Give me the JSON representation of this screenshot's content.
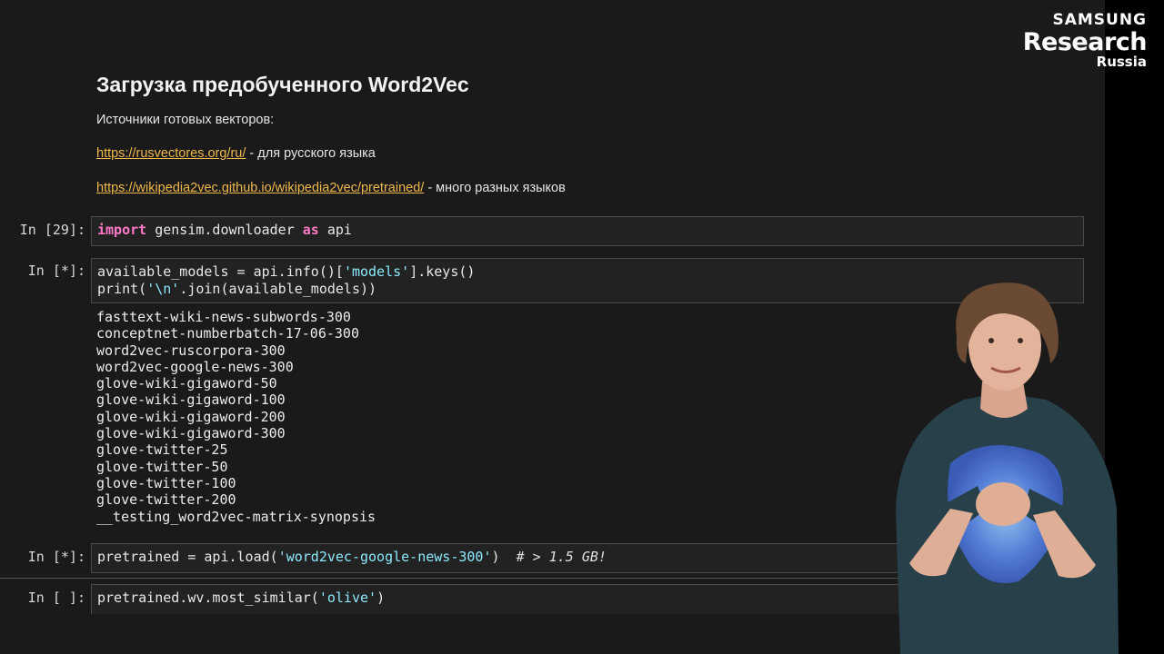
{
  "brand": {
    "line1": "SAMSUNG",
    "line2": "Research",
    "line3": "Russia"
  },
  "markdown": {
    "title": "Загрузка предобученного Word2Vec",
    "sources_label": "Источники готовых векторов:",
    "link1": {
      "url": "https://rusvectores.org/ru/",
      "suffix": " - для русского языка"
    },
    "link2": {
      "url": "https://wikipedia2vec.github.io/wikipedia2vec/pretrained/",
      "suffix": " - много разных языков"
    }
  },
  "cells": [
    {
      "prompt": "In [29]:",
      "tokens": {
        "kw1": "import",
        "mod": " gensim.downloader ",
        "kw2": "as",
        "alias": " api"
      }
    },
    {
      "prompt": "In [*]:",
      "line1": {
        "a": "available_models = api.info()[",
        "s": "'models'",
        "b": "].keys()"
      },
      "line2": {
        "a": "print(",
        "s": "'\\n'",
        "b": ".join(available_models))"
      }
    },
    {
      "prompt": "In [*]:",
      "a": "pretrained = api.load(",
      "s": "'word2vec-google-news-300'",
      "b": ")  ",
      "comment": "# > 1.5 GB!"
    },
    {
      "prompt": "In [ ]:",
      "a": "pretrained.wv.most_similar(",
      "s": "'olive'",
      "b": ")"
    }
  ],
  "output_models": [
    "fasttext-wiki-news-subwords-300",
    "conceptnet-numberbatch-17-06-300",
    "word2vec-ruscorpora-300",
    "word2vec-google-news-300",
    "glove-wiki-gigaword-50",
    "glove-wiki-gigaword-100",
    "glove-wiki-gigaword-200",
    "glove-wiki-gigaword-300",
    "glove-twitter-25",
    "glove-twitter-50",
    "glove-twitter-100",
    "glove-twitter-200",
    "__testing_word2vec-matrix-synopsis"
  ],
  "colors": {
    "link": "#f0b84a",
    "keyword": "#ff79c6",
    "string": "#8be9fd",
    "background": "#1a1a1a"
  }
}
